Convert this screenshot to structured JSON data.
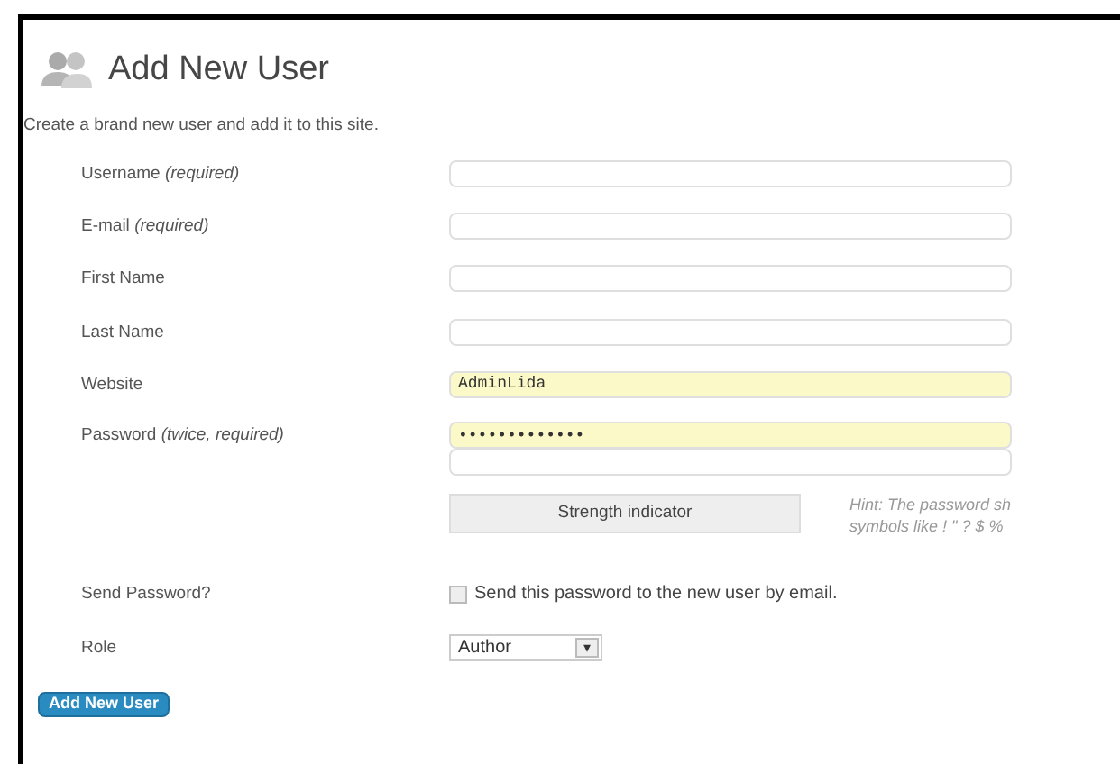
{
  "header": {
    "title": "Add New User",
    "description": "Create a brand new user and add it to this site."
  },
  "rows": [
    {
      "kind": "text",
      "label": "Username *(required)*",
      "inputs": [
        {
          "highlighted": false
        }
      ]
    },
    {
      "kind": "text",
      "label": "E-mail *(required)*",
      "inputs": [
        {
          "highlighted": false
        }
      ]
    },
    {
      "kind": "text",
      "label": "First Name",
      "inputs": [
        {
          "highlighted": false
        }
      ]
    },
    {
      "kind": "text",
      "label": "Last Name",
      "inputs": [
        {
          "highlighted": false
        }
      ]
    },
    {
      "kind": "text",
      "label": "Website",
      "inputs": [
        {
          "value": "AdminLida",
          "highlighted": true
        }
      ]
    },
    {
      "kind": "password",
      "label": "Password *(twice, required)*",
      "inputs": [
        {
          "value": "•••••••••••••",
          "highlighted": true
        },
        {
          "highlighted": false
        }
      ],
      "strength": "Strength indicator",
      "hint": [
        "Hint: The password sh",
        "symbols like ! \" ? $ % "
      ]
    },
    {
      "kind": "checkbox",
      "label": "Send Password?",
      "checked": false,
      "text": "Send this password to the new user by email."
    },
    {
      "kind": "select",
      "label": "Role",
      "value": "Author",
      "arrow": "▾"
    }
  ],
  "submit": "Add New User"
}
